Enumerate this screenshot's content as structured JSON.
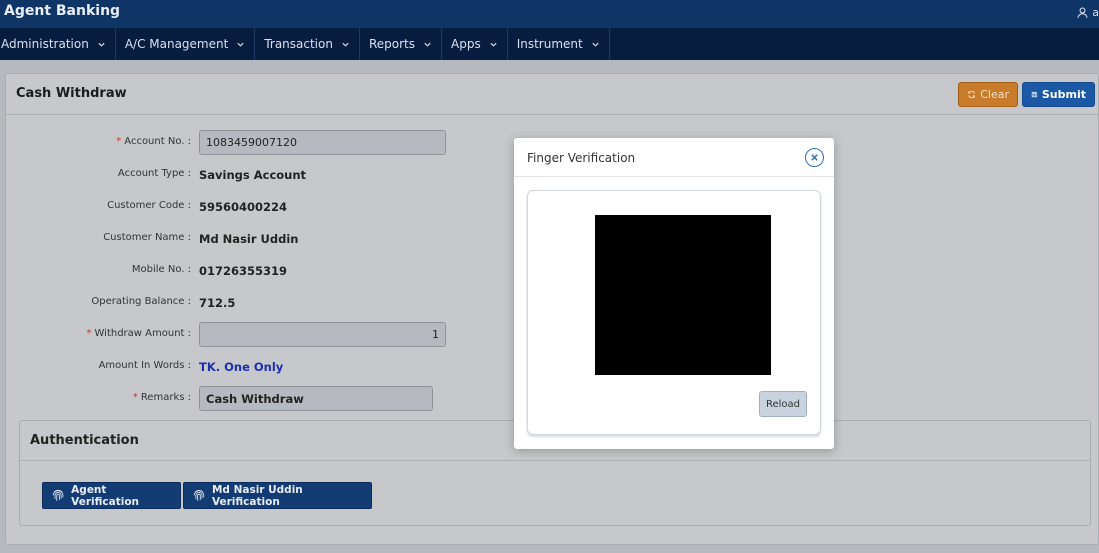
{
  "app": {
    "title": "Agent Banking",
    "user_initial": "a"
  },
  "menu": [
    {
      "label": "Administration"
    },
    {
      "label": "A/C Management"
    },
    {
      "label": "Transaction"
    },
    {
      "label": "Reports"
    },
    {
      "label": "Apps"
    },
    {
      "label": "Instrument"
    }
  ],
  "page": {
    "title": "Cash Withdraw",
    "clear_label": "Clear",
    "submit_label": "Submit"
  },
  "form": {
    "account_no_label": "Account No. :",
    "account_no_value": "1083459007120",
    "account_type_label": "Account Type :",
    "account_type_value": "Savings Account",
    "customer_code_label": "Customer Code :",
    "customer_code_value": "59560400224",
    "customer_name_label": "Customer Name :",
    "customer_name_value": "Md Nasir Uddin",
    "mobile_label": "Mobile No. :",
    "mobile_value": "01726355319",
    "balance_label": "Operating Balance :",
    "balance_value": "712.5",
    "withdraw_label": "Withdraw Amount :",
    "withdraw_value": "1",
    "words_label": "Amount In Words :",
    "words_value": "TK. One Only",
    "remarks_label": "Remarks :",
    "remarks_value": "Cash Withdraw",
    "required_mark": "*"
  },
  "auth": {
    "title": "Authentication",
    "agent_button": "Agent Verification",
    "customer_button": "Md Nasir Uddin Verification"
  },
  "modal": {
    "title": "Finger Verification",
    "reload_label": "Reload"
  },
  "colors": {
    "topbar": "#0f3566",
    "menubar": "#061d3f",
    "clear_button": "#c87b2a",
    "submit_button": "#1b58a6",
    "amount_words": "#1c2fb0",
    "required": "#c0392b"
  }
}
